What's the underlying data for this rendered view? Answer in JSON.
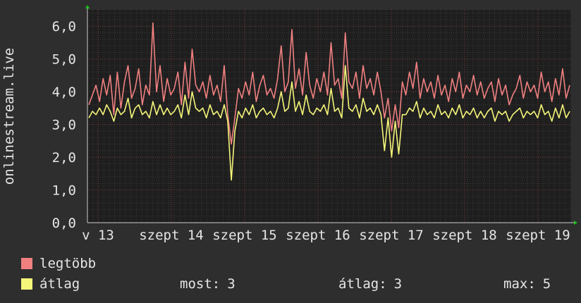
{
  "colors": {
    "background": "#2e2e2e",
    "plot_bg": "#1e1e1e",
    "grid_major": "#7a3a3a",
    "grid_minor": "#3a3a3a",
    "text": "#e6e6e6",
    "max_series": "#f08080",
    "avg_series": "#f5f57a",
    "arrow": "#1fbf1f"
  },
  "legend": {
    "max_label": "legtöbb",
    "avg_label": "átlag",
    "most_label": "most:",
    "most_value": "3",
    "atlag_label": "átlag:",
    "atlag_value": "3",
    "max_stat_label": "max:",
    "max_stat_value": "5"
  },
  "chart_data": {
    "type": "line",
    "title": "",
    "ylabel": "onlinestream.live",
    "xlabel": "",
    "ylim": [
      0,
      6.5
    ],
    "yticks": [
      "0,0",
      "1,0",
      "2,0",
      "3,0",
      "4,0",
      "5,0",
      "6,0"
    ],
    "xtick_labels": [
      "v 13",
      "szept 14",
      "szept 15",
      "szept 16",
      "szept 17",
      "szept 18",
      "szept 19",
      "szept"
    ],
    "grid": true,
    "series": [
      {
        "name": "legtöbb",
        "values": [
          3.6,
          3.9,
          4.2,
          3.7,
          4.4,
          3.9,
          4.5,
          3.3,
          4.6,
          3.5,
          4.3,
          4.8,
          3.8,
          4.1,
          4.7,
          3.6,
          4.2,
          3.9,
          6.1,
          4.0,
          4.8,
          3.7,
          4.4,
          3.9,
          4.1,
          4.6,
          3.6,
          4.9,
          3.8,
          5.3,
          4.2,
          4.0,
          4.3,
          3.8,
          4.5,
          3.9,
          4.2,
          3.7,
          4.8,
          3.3,
          2.4,
          3.2,
          4.1,
          3.8,
          4.3,
          3.9,
          4.6,
          3.7,
          4.2,
          4.5,
          3.9,
          4.1,
          3.8,
          4.4,
          5.4,
          4.0,
          4.3,
          5.9,
          4.1,
          4.7,
          3.9,
          5.2,
          4.2,
          3.8,
          4.4,
          4.0,
          4.6,
          3.9,
          5.5,
          4.2,
          4.4,
          3.8,
          5.8,
          4.3,
          4.1,
          4.6,
          3.8,
          4.8,
          4.1,
          4.4,
          3.9,
          4.6,
          4.0,
          3.2,
          3.8,
          2.8,
          3.6,
          2.9,
          4.3,
          3.9,
          4.6,
          4.1,
          4.9,
          3.8,
          4.4,
          4.0,
          4.3,
          3.8,
          4.5,
          3.9,
          4.2,
          3.7,
          4.4,
          4.0,
          4.6,
          3.8,
          4.2,
          4.0,
          4.5,
          3.9,
          4.3,
          3.8,
          4.1,
          4.3,
          3.7,
          4.4,
          3.9,
          4.2,
          3.6,
          3.9,
          4.1,
          4.5,
          3.8,
          4.3,
          4.0,
          4.2,
          3.8,
          4.6,
          4.0,
          4.3,
          3.7,
          4.4,
          3.9,
          4.7,
          3.8,
          4.2
        ]
      },
      {
        "name": "átlag",
        "values": [
          3.2,
          3.4,
          3.3,
          3.5,
          3.3,
          3.6,
          3.4,
          3.1,
          3.5,
          3.3,
          3.4,
          3.8,
          3.2,
          3.5,
          3.6,
          3.3,
          3.4,
          3.2,
          3.7,
          3.3,
          3.6,
          3.3,
          3.5,
          3.3,
          3.4,
          3.6,
          3.2,
          3.9,
          3.3,
          4.0,
          3.5,
          3.4,
          3.5,
          3.2,
          3.6,
          3.3,
          3.4,
          3.2,
          3.6,
          3.1,
          1.3,
          2.8,
          3.4,
          3.2,
          3.5,
          3.3,
          3.6,
          3.2,
          3.4,
          3.5,
          3.3,
          3.4,
          3.2,
          3.5,
          4.0,
          3.4,
          3.5,
          4.3,
          3.4,
          3.7,
          3.3,
          3.9,
          3.4,
          3.3,
          3.5,
          3.4,
          3.6,
          3.3,
          4.1,
          3.4,
          3.5,
          3.2,
          4.8,
          3.5,
          3.4,
          3.6,
          3.2,
          3.8,
          3.4,
          3.5,
          3.3,
          3.6,
          3.3,
          2.2,
          3.2,
          2.0,
          3.1,
          2.1,
          3.3,
          3.3,
          3.5,
          3.4,
          3.7,
          3.2,
          3.5,
          3.3,
          3.4,
          3.2,
          3.6,
          3.3,
          3.4,
          3.2,
          3.5,
          3.3,
          3.6,
          3.2,
          3.4,
          3.3,
          3.5,
          3.2,
          3.4,
          3.2,
          3.4,
          3.5,
          3.1,
          3.4,
          3.3,
          3.4,
          3.1,
          3.3,
          3.4,
          3.5,
          3.2,
          3.4,
          3.3,
          3.4,
          3.2,
          3.6,
          3.3,
          3.4,
          3.1,
          3.5,
          3.2,
          3.6,
          3.2,
          3.4
        ]
      }
    ]
  }
}
